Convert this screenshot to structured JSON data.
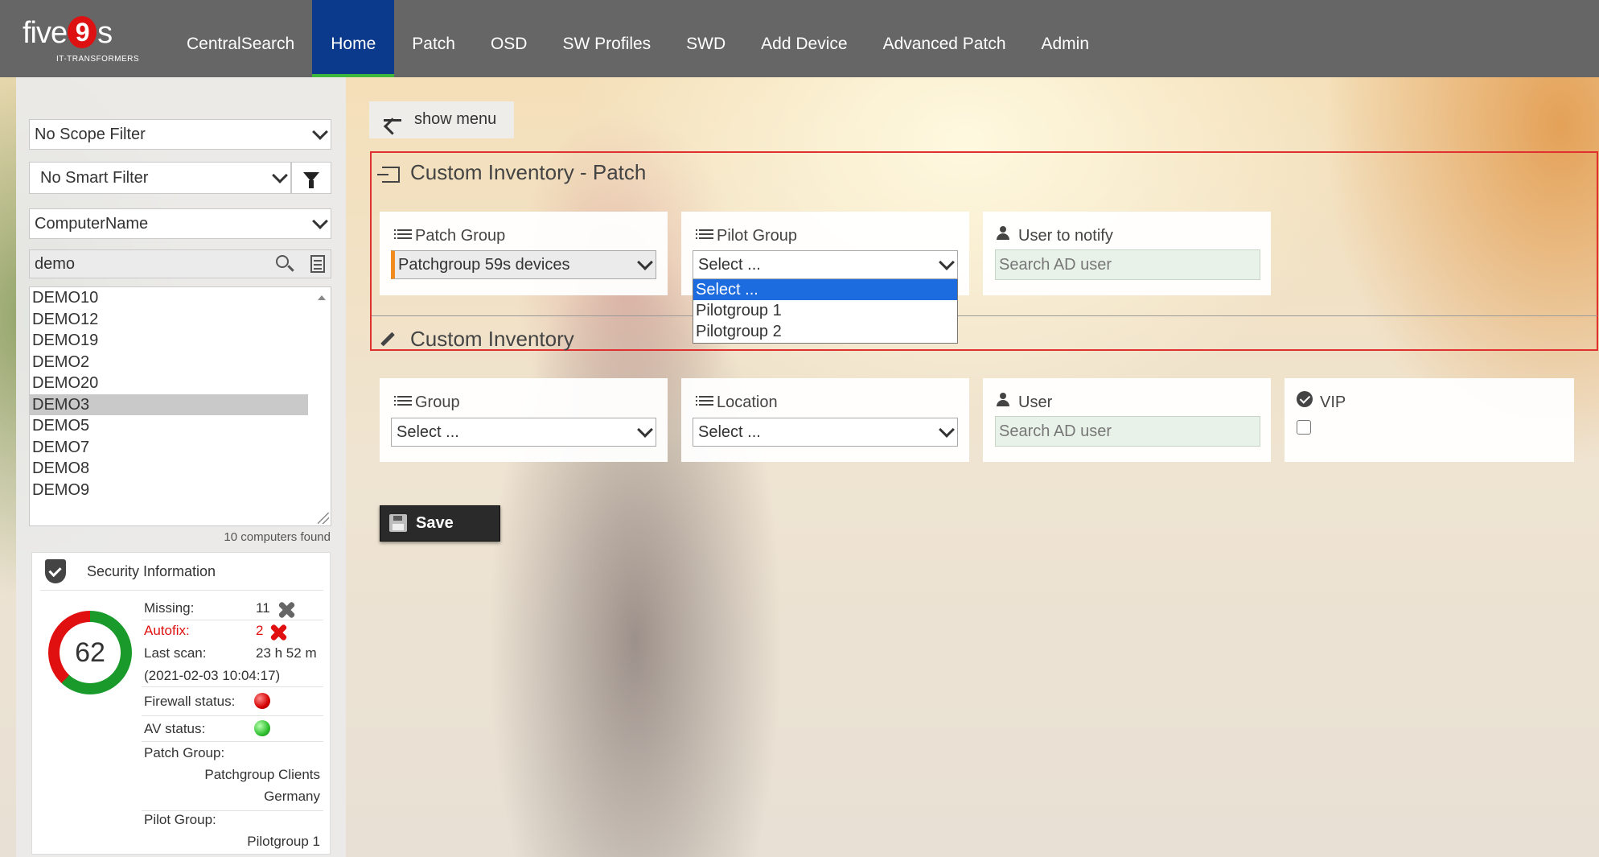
{
  "nav": {
    "logo_main_prefix": "five",
    "logo_nine": "9",
    "logo_main_suffix": "s",
    "logo_sub": "IT-TRANSFORMERS",
    "items": [
      "CentralSearch",
      "Home",
      "Patch",
      "OSD",
      "SW Profiles",
      "SWD",
      "Add Device",
      "Advanced Patch",
      "Admin"
    ],
    "active": "Home"
  },
  "left": {
    "scope_filter": "No Scope Filter",
    "smart_filter": "No Smart Filter",
    "search_field": "ComputerName",
    "search_value": "demo",
    "computers": [
      "DEMO10",
      "DEMO12",
      "DEMO19",
      "DEMO2",
      "DEMO20",
      "DEMO3",
      "DEMO5",
      "DEMO7",
      "DEMO8",
      "DEMO9"
    ],
    "selected_computer": "DEMO3",
    "found_text": "10 computers found"
  },
  "security": {
    "title": "Security Information",
    "score": "62",
    "score_fraction": 0.62,
    "colors": {
      "good": "#1a9a2a",
      "bad": "#e01010"
    },
    "missing_label": "Missing:",
    "missing_value": "11",
    "autofix_label": "Autofix:",
    "autofix_value": "2",
    "last_scan_label": "Last scan:",
    "last_scan_value": "23 h 52 m",
    "last_scan_date": "(2021-02-03 10:04:17)",
    "firewall_label": "Firewall status:",
    "av_label": "AV status:",
    "patch_group_label": "Patch Group:",
    "patch_group_line1": "Patchgroup Clients",
    "patch_group_line2": "Germany",
    "pilot_group_label": "Pilot Group:",
    "pilot_group_value": "Pilotgroup 1"
  },
  "main": {
    "show_menu": "show menu",
    "section1": {
      "title": "Custom Inventory - Patch",
      "patch_group_label": "Patch Group",
      "patch_group_value": "Patchgroup 59s devices",
      "pilot_group_label": "Pilot Group",
      "pilot_group_value": "Select ...",
      "pilot_options": [
        "Select ...",
        "Pilotgroup 1",
        "Pilotgroup 2"
      ],
      "notify_label": "User to notify",
      "notify_placeholder": "Search AD user"
    },
    "section2": {
      "title": "Custom Inventory",
      "group_label": "Group",
      "group_value": "Select ...",
      "location_label": "Location",
      "location_value": "Select ...",
      "user_label": "User",
      "user_placeholder": "Search AD user",
      "vip_label": "VIP"
    },
    "save_label": "Save"
  }
}
